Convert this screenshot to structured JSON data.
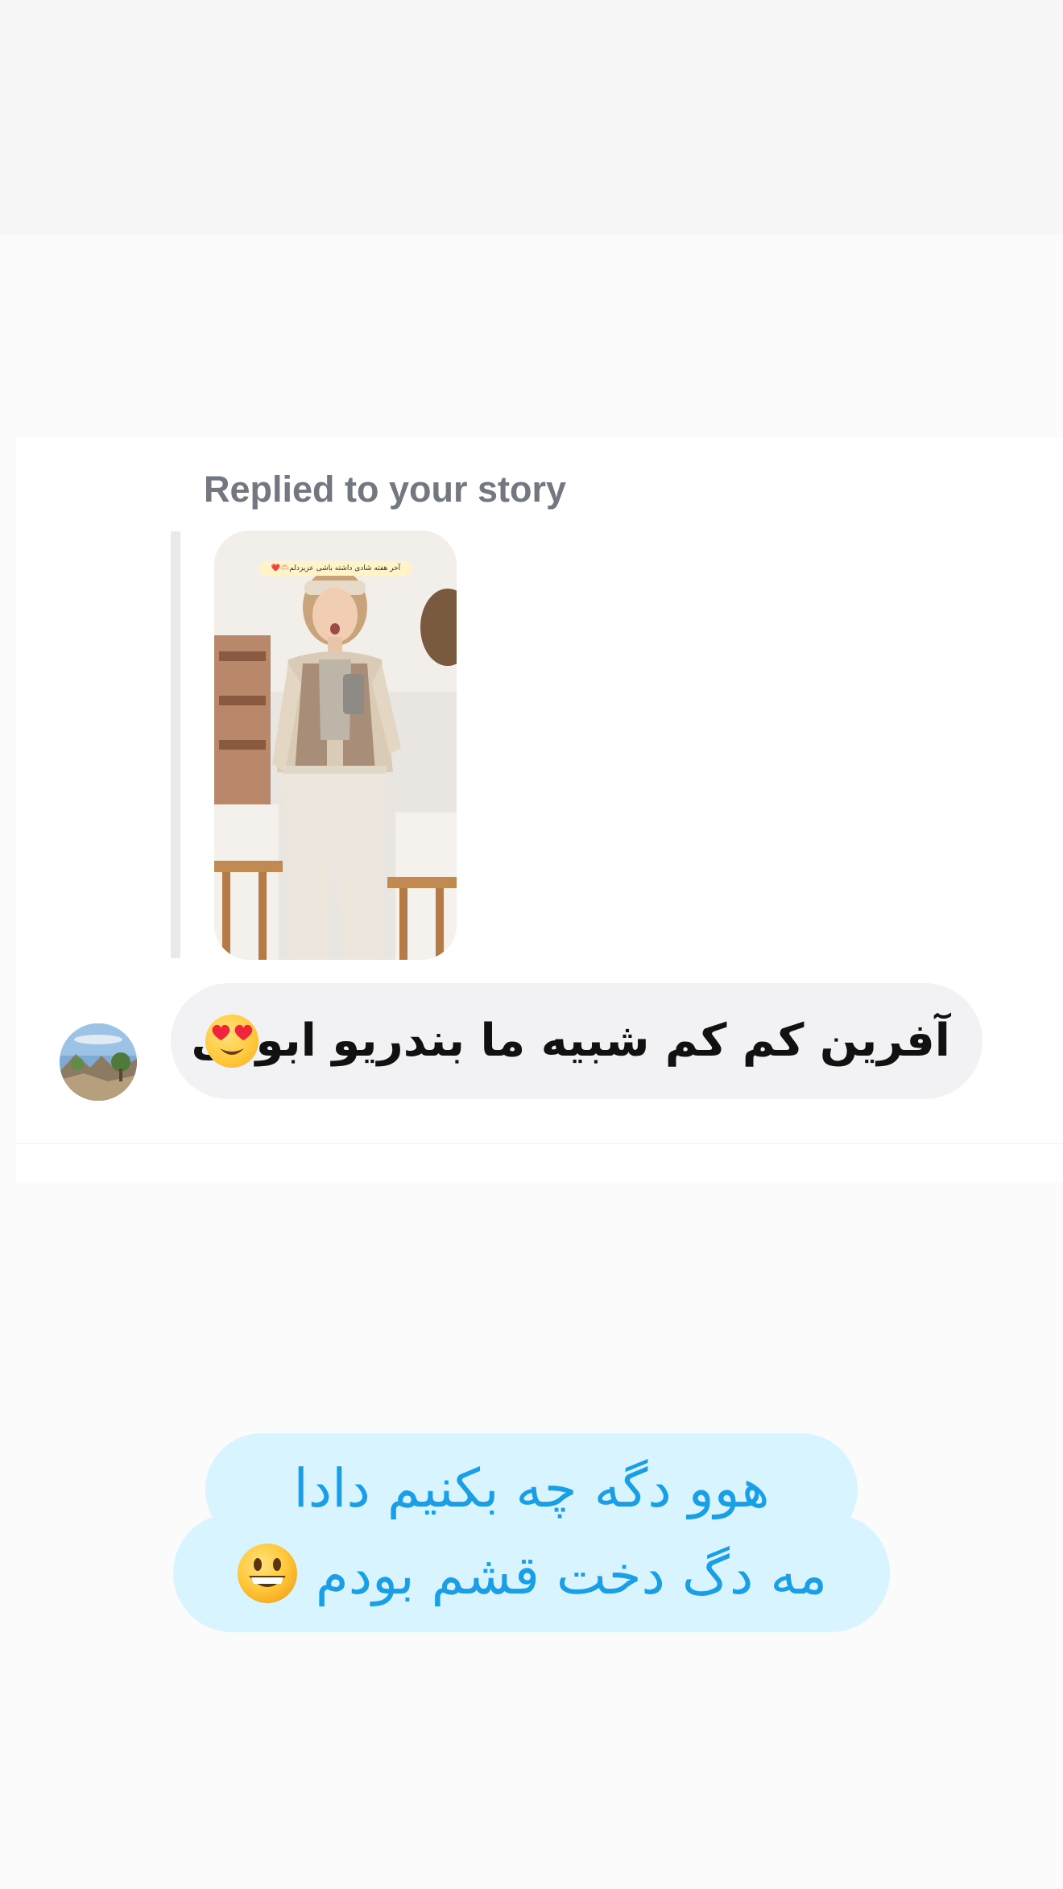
{
  "reply_header": {
    "label": "Replied to your story"
  },
  "story": {
    "caption": "آخر هفته شادی داشته باشی عزیزدلم🫶🏻❤️"
  },
  "message": {
    "text": "آفرین کم کم شبیه ما بندریو ابودی",
    "emoji": "smiling-face-with-heart-eyes-icon"
  },
  "story_caption": {
    "line1": "هوو دگه چه بکنیم دادا",
    "line2": "مه دگ دخت قشم بودم",
    "emoji": "grinning-face-icon"
  },
  "colors": {
    "caption_background": "#d8f4fe",
    "caption_text": "#1a9ee6",
    "bubble_background": "#f2f2f4",
    "label_gray": "#737880"
  }
}
